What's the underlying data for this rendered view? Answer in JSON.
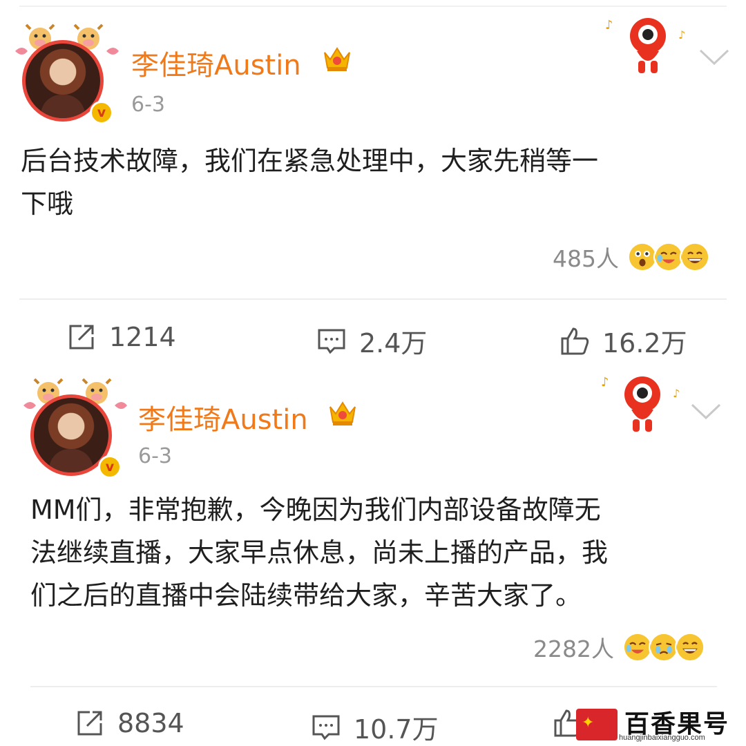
{
  "posts": [
    {
      "username": "李佳琦Austin",
      "date": "6-3",
      "content_lines": [
        "后台技术故障，我们在紧急处理中，大家先稍等一",
        "下哦"
      ],
      "reactions_count": "485人",
      "actions": {
        "repost": "1214",
        "comment": "2.4万",
        "like": "16.2万"
      }
    },
    {
      "username": "李佳琦Austin",
      "date": "6-3",
      "content_lines": [
        "MM们，非常抱歉，今晚因为我们内部设备故障无",
        "法继续直播，大家早点休息，尚未上播的产品，我",
        "们之后的直播中会陆续带给大家，辛苦大家了。"
      ],
      "reactions_count": "2282人",
      "actions": {
        "repost": "8834",
        "comment": "10.7万",
        "like": ""
      }
    }
  ],
  "verified_badge": "v",
  "watermark": {
    "text": "百香果号",
    "url": "huangjinbaixiangguo.com"
  },
  "colors": {
    "username": "#f07a1a",
    "verified": "#f5b800",
    "avatar_ring": "#e8463a"
  },
  "icons": [
    "cow-pendant-icon",
    "crown-icon",
    "mascot-icon",
    "chevron-down-icon",
    "repost-icon",
    "comment-icon",
    "like-icon",
    "surprised-emoji-icon",
    "crying-laughing-emoji-icon",
    "grinning-emoji-icon",
    "tears-emoji-icon"
  ]
}
